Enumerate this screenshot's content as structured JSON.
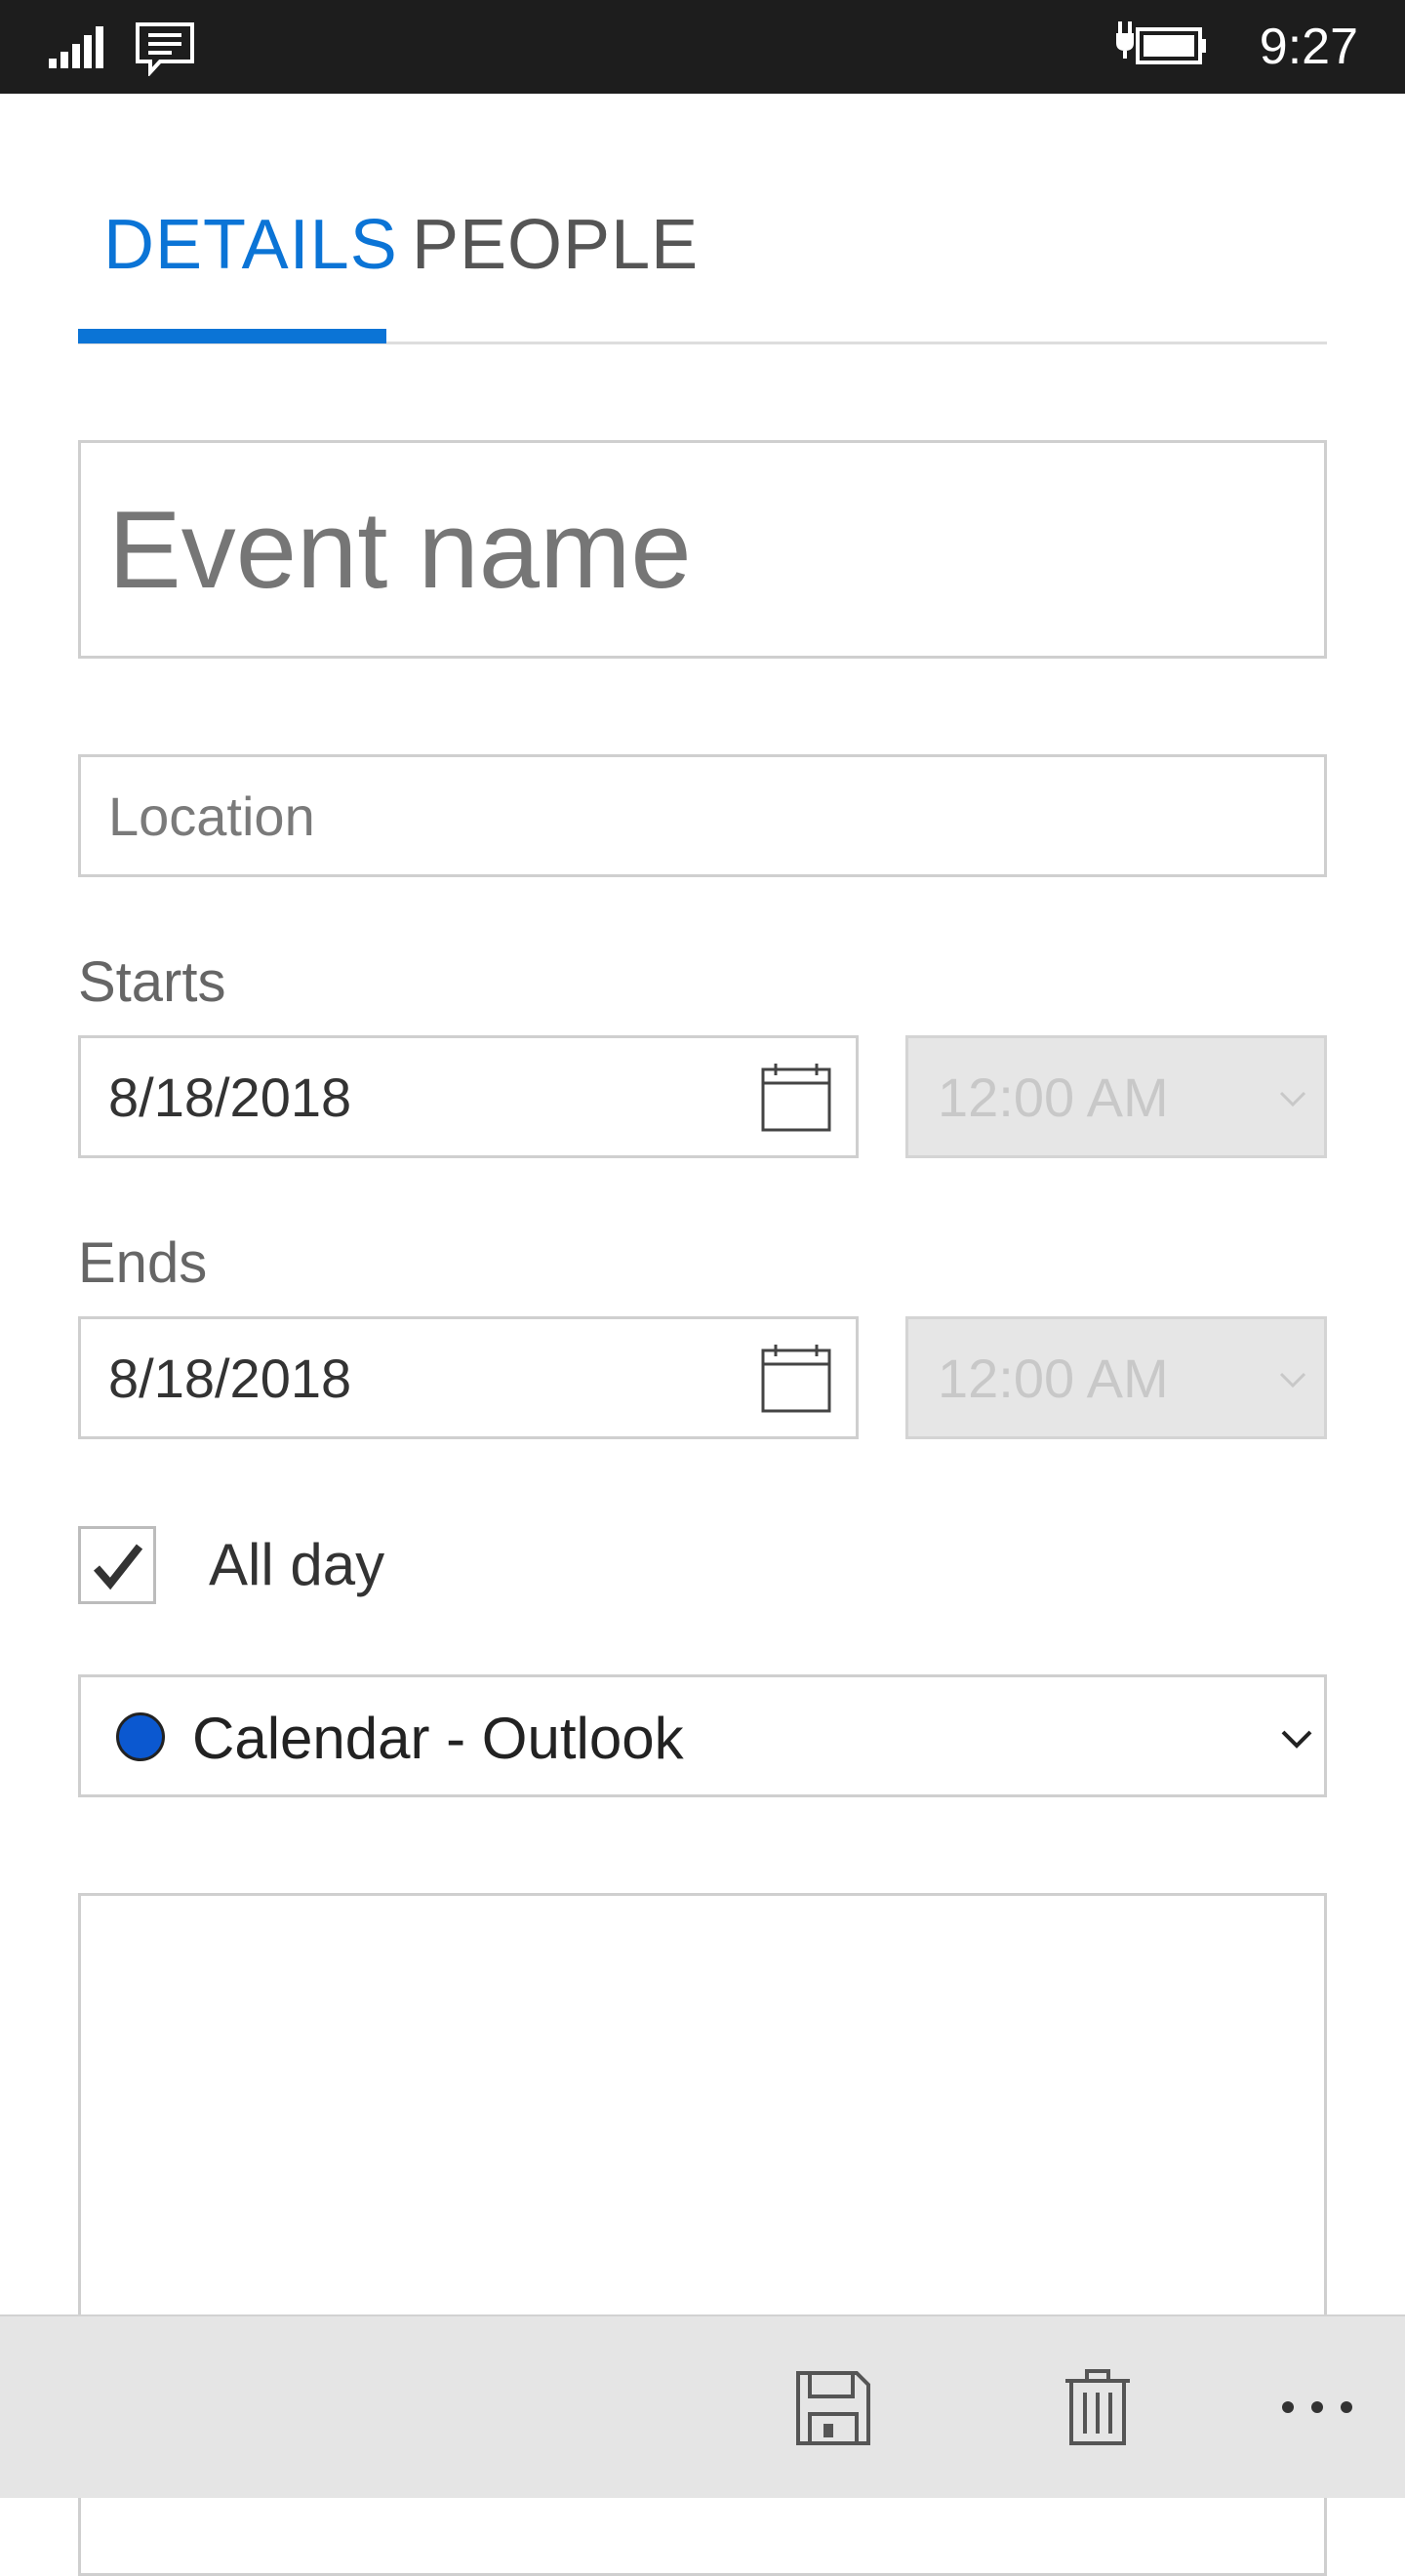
{
  "status_bar": {
    "time": "9:27",
    "icons": [
      "signal-icon",
      "message-icon",
      "battery-charging-icon"
    ]
  },
  "tabs": [
    {
      "label": "DETAILS",
      "active": true
    },
    {
      "label": "PEOPLE",
      "active": false
    }
  ],
  "form": {
    "event_name_placeholder": "Event name",
    "location_placeholder": "Location",
    "starts_label": "Starts",
    "start_date": "8/18/2018",
    "start_time": "12:00 AM",
    "ends_label": "Ends",
    "end_date": "8/18/2018",
    "end_time": "12:00 AM",
    "all_day_label": "All day",
    "all_day_checked": true,
    "calendar": "Calendar - Outlook",
    "calendar_color": "#0b58d0"
  },
  "app_bar": {
    "icons": [
      "save-icon",
      "delete-icon",
      "more-icon"
    ]
  },
  "colors": {
    "accent": "#0b74d6",
    "status_bar_bg": "#1d1d1d",
    "app_bar_bg": "#e5e5e5"
  }
}
